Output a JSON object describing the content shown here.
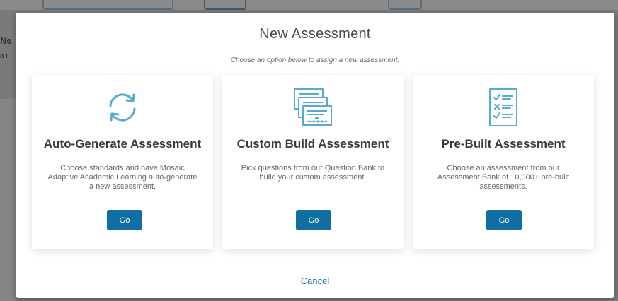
{
  "background": {
    "left_title": "Ne",
    "left_sub": "a r"
  },
  "modal": {
    "title": "New Assessment",
    "subtitle": "Choose an option below to assign a new assessment:",
    "cancel_label": "Cancel"
  },
  "options": [
    {
      "icon": "refresh-arrows-icon",
      "title": "Auto-Generate Assessment",
      "description": "Choose standards and have Mosaic Adaptive Academic Learning auto-generate a new assessment.",
      "button_label": "Go"
    },
    {
      "icon": "stacked-documents-icon",
      "title": "Custom Build Assessment",
      "description": "Pick questions from our Question Bank to build your custom assessment.",
      "button_label": "Go"
    },
    {
      "icon": "checklist-icon",
      "title": "Pre-Built Assessment",
      "description": "Choose an assessment from our Assessment Bank of 10,000+ pre-built assessments.",
      "button_label": "Go"
    }
  ],
  "colors": {
    "accent": "#0f6fa3",
    "icon": "#5aa9d0",
    "link": "#1e6fa0"
  }
}
